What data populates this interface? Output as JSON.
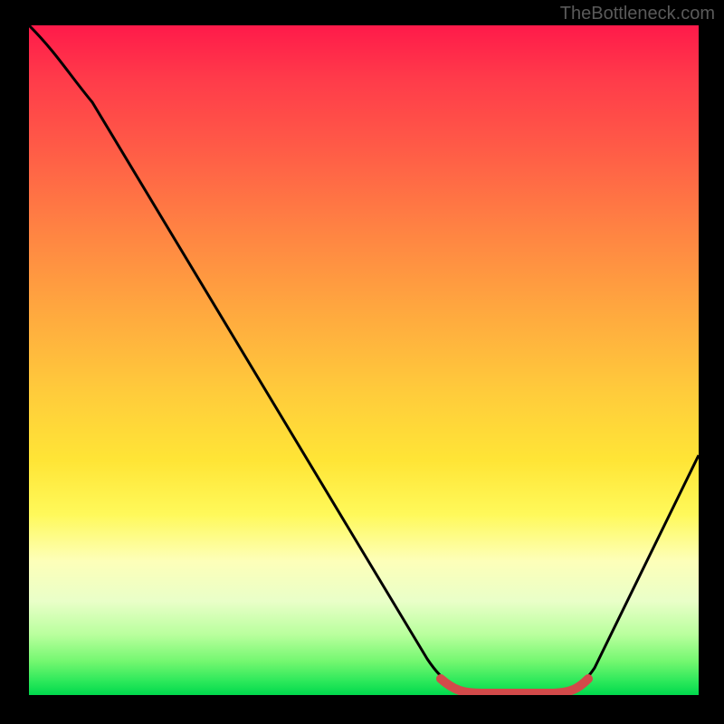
{
  "watermark": "TheBottleneck.com",
  "chart_data": {
    "type": "line",
    "title": "",
    "xlabel": "",
    "ylabel": "",
    "xlim": [
      0,
      100
    ],
    "ylim": [
      0,
      100
    ],
    "series": [
      {
        "name": "bottleneck-curve",
        "x": [
          0,
          6,
          12,
          18,
          24,
          30,
          36,
          42,
          48,
          54,
          60,
          64,
          68,
          72,
          76,
          80,
          84,
          88,
          92,
          96,
          100
        ],
        "values": [
          100,
          94,
          86,
          77,
          68,
          59,
          50,
          41,
          32,
          23,
          14,
          8,
          3,
          0,
          0,
          0,
          3,
          10,
          18,
          27,
          36
        ]
      },
      {
        "name": "optimal-zone",
        "x": [
          62,
          66,
          70,
          74,
          78,
          82
        ],
        "values": [
          3,
          1,
          0,
          0,
          1,
          3
        ]
      }
    ],
    "gradient_axis": "y",
    "gradient_semantics": "top=worst (red), bottom=best (green)"
  },
  "colors": {
    "background": "#000000",
    "curve": "#000000",
    "optimal_zone_stroke": "#d24a4a"
  }
}
